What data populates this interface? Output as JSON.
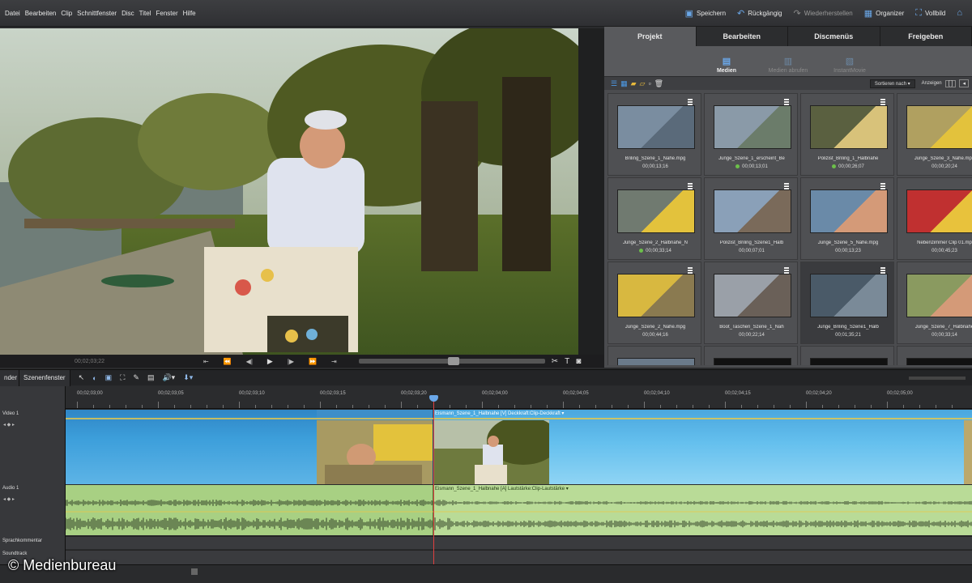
{
  "menu": [
    "Datei",
    "Bearbeiten",
    "Clip",
    "Schnittfenster",
    "Disc",
    "Titel",
    "Fenster",
    "Hilfe"
  ],
  "actions": [
    {
      "label": "Speichern",
      "icon": "save-icon"
    },
    {
      "label": "Rückgängig",
      "icon": "undo-icon"
    },
    {
      "label": "Wiederherstellen",
      "icon": "redo-icon"
    },
    {
      "label": "Organizer",
      "icon": "organizer-icon"
    },
    {
      "label": "Vollbild",
      "icon": "fullscreen-icon"
    }
  ],
  "monitor": {
    "timecode": "00;02;03;22"
  },
  "panel": {
    "tabs": [
      "Projekt",
      "Bearbeiten",
      "Discmenüs",
      "Freigeben"
    ],
    "active_tab": "Projekt",
    "modes": [
      {
        "label": "Medien",
        "active": true
      },
      {
        "label": "Medien abrufen",
        "active": false
      },
      {
        "label": "InstantMovie",
        "active": false
      }
    ],
    "sort_label": "Sortieren nach",
    "show_label": "Anzeigen"
  },
  "media": [
    {
      "name": "Briling_Szene_1_Nahe.mpg",
      "duration": "00;00;13;16",
      "dot": false
    },
    {
      "name": "Junge_Szene_1_erscheint_Be",
      "duration": "00;00;13;01",
      "dot": true
    },
    {
      "name": "Polizist_Briling_1_Halbnahe",
      "duration": "00;00;26;07",
      "dot": true
    },
    {
      "name": "Junge_Szene_3_Nahe.mpg",
      "duration": "00;00;20;24",
      "dot": false
    },
    {
      "name": "Junge_Szene_2_Halbnahe_N",
      "duration": "00;00;33;14",
      "dot": true
    },
    {
      "name": "Polizist_Briling_Szene1_Halb",
      "duration": "00;00;07;01",
      "dot": false
    },
    {
      "name": "Junge_Szene_5_Nahe.mpg",
      "duration": "00;00;13;23",
      "dot": false
    },
    {
      "name": "Nebenzimmer Clip 01.mp",
      "duration": "00;00;45;23",
      "dot": false
    },
    {
      "name": "Junge_Szene_2_Nahe.mpg",
      "duration": "00;00;44;16",
      "dot": false
    },
    {
      "name": "Boot_Taschen_Szene_1_Nah",
      "duration": "00;00;22;14",
      "dot": false
    },
    {
      "name": "Junge_Briling_Szene1_Halb",
      "duration": "00;01;35;21",
      "dot": false
    },
    {
      "name": "Junge_Szene_7_Halbnahe",
      "duration": "00;00;33;14",
      "dot": false
    }
  ],
  "timeline": {
    "tabs": [
      "nder",
      "Szenenfenster"
    ],
    "ruler": [
      "00;02;03;00",
      "00;02;03;05",
      "00;02;03;10",
      "00;02;03;15",
      "00;02;03;20",
      "00;02;04;00",
      "00;02;04;05",
      "00;02;04;10",
      "00;02;04;15",
      "00;02;04;20",
      "00;02;05;00"
    ],
    "tracks": {
      "video": "Video 1",
      "audio": "Audio 1",
      "narration": "Sprachkommentar",
      "soundtrack": "Soundtrack"
    },
    "video_clip_label": "Eismann_Szene_1_Halbnahe [V]  Deckkraft:Clip-Deckkraft ▾",
    "audio_clip_label": "Eismann_Szene_1_Halbnahe [A]  Lautstärke:Clip-Lautstärke ▾"
  },
  "copyright": "© Medienbureau"
}
